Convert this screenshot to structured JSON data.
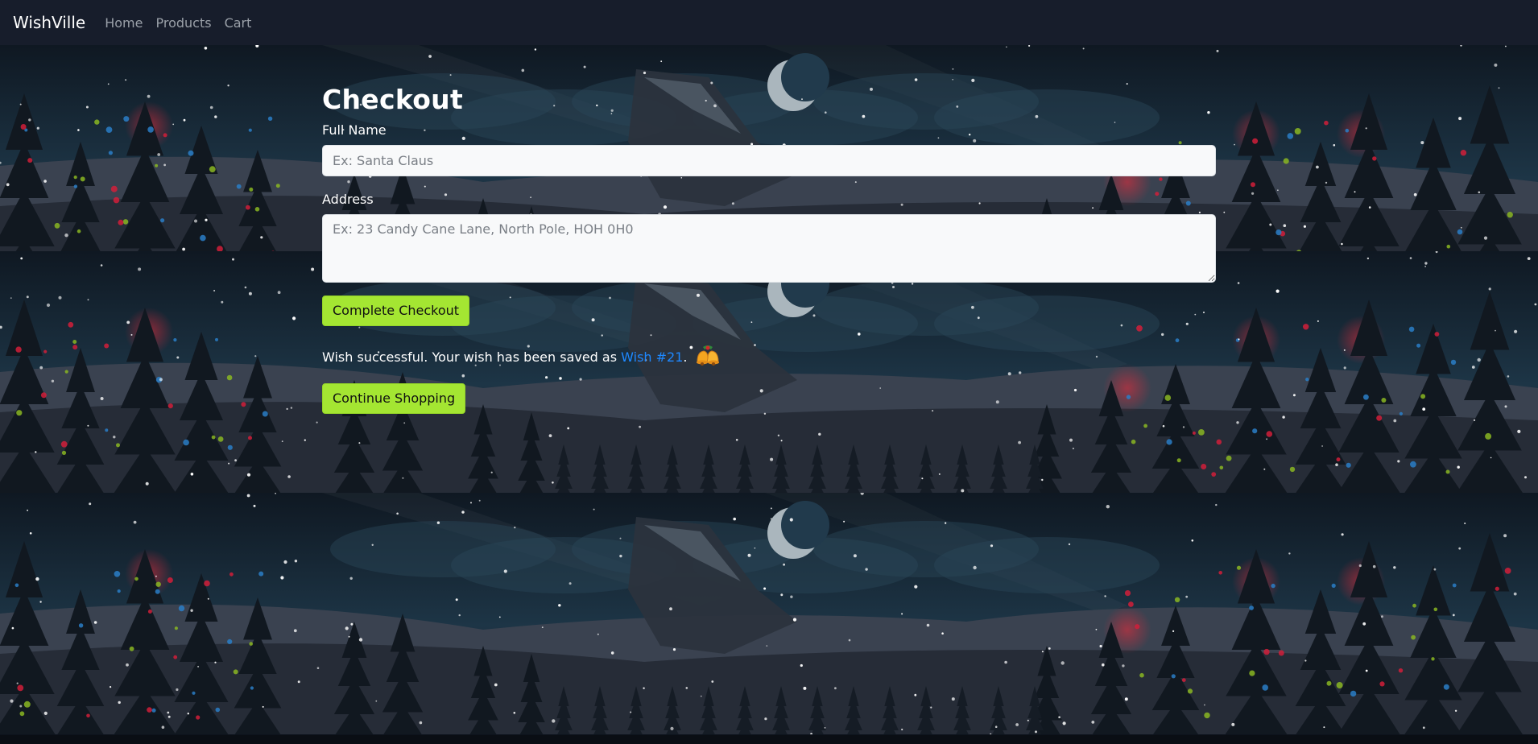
{
  "nav": {
    "brand": "WishVille",
    "links": [
      "Home",
      "Products",
      "Cart"
    ]
  },
  "checkout": {
    "title": "Checkout",
    "full_name_label": "Full Name",
    "full_name_placeholder": "Ex: Santa Claus",
    "address_label": "Address",
    "address_placeholder": "Ex: 23 Candy Cane Lane, North Pole, HOH 0H0",
    "submit_label": "Complete Checkout",
    "message_prefix": "Wish successful. Your wish has been saved as ",
    "wish_link": "Wish #21",
    "message_suffix": ".",
    "continue_label": "Continue Shopping"
  },
  "icons": {
    "bells": "christmas-bells-icon"
  },
  "colors": {
    "navbar_bg": "#171d2b",
    "accent_button": "#a4e632",
    "link": "#1e88ff",
    "input_bg": "#f8f9fa"
  }
}
